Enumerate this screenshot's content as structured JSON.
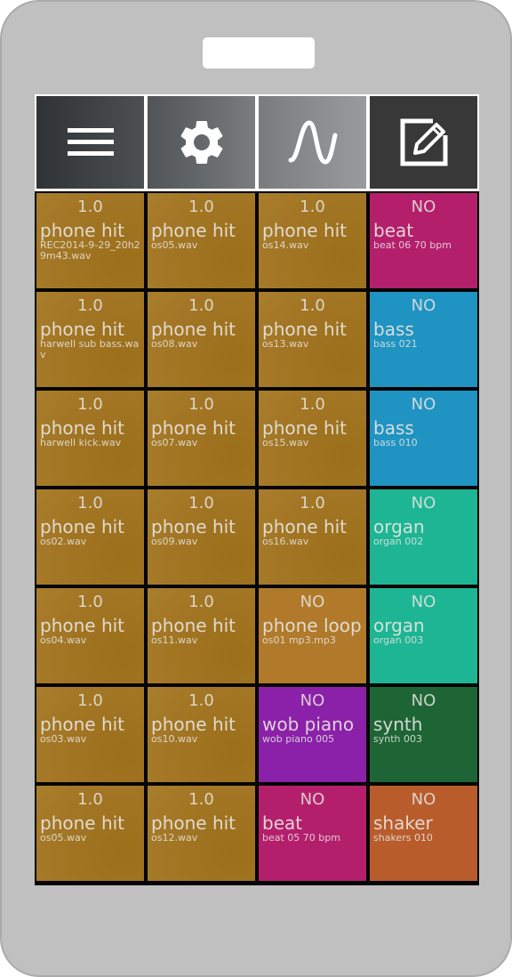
{
  "toolbar": {
    "buttons": [
      {
        "name": "menu-button",
        "icon": "menu-icon"
      },
      {
        "name": "settings-button",
        "icon": "gear-icon"
      },
      {
        "name": "waveform-button",
        "icon": "sine-wave-icon"
      },
      {
        "name": "edit-button",
        "icon": "edit-icon"
      }
    ]
  },
  "colors": {
    "brown": "#a27624",
    "brown_light": "#b07a2a",
    "magenta": "#b41f6c",
    "blue": "#1f93c1",
    "teal": "#1db594",
    "purple": "#8b21a8",
    "green": "#1e6535",
    "orange": "#b85c2c"
  },
  "pads": [
    [
      {
        "vol": "1.0",
        "name": "phone hit",
        "file": "REC2014-9-29_20h29m43.wav",
        "color": "brown"
      },
      {
        "vol": "1.0",
        "name": "phone hit",
        "file": "os05.wav",
        "color": "brown"
      },
      {
        "vol": "1.0",
        "name": "phone hit",
        "file": "os14.wav",
        "color": "brown"
      },
      {
        "vol": "NO",
        "name": "beat",
        "file": "beat 06 70 bpm",
        "color": "magenta"
      }
    ],
    [
      {
        "vol": "1.0",
        "name": "phone hit",
        "file": "harwell sub bass.wav",
        "color": "brown"
      },
      {
        "vol": "1.0",
        "name": "phone hit",
        "file": "os08.wav",
        "color": "brown"
      },
      {
        "vol": "1.0",
        "name": "phone hit",
        "file": "os13.wav",
        "color": "brown"
      },
      {
        "vol": "NO",
        "name": "bass",
        "file": "bass 021",
        "color": "blue"
      }
    ],
    [
      {
        "vol": "1.0",
        "name": "phone hit",
        "file": "harwell kick.wav",
        "color": "brown"
      },
      {
        "vol": "1.0",
        "name": "phone hit",
        "file": "os07.wav",
        "color": "brown"
      },
      {
        "vol": "1.0",
        "name": "phone hit",
        "file": "os15.wav",
        "color": "brown"
      },
      {
        "vol": "NO",
        "name": "bass",
        "file": "bass 010",
        "color": "blue"
      }
    ],
    [
      {
        "vol": "1.0",
        "name": "phone hit",
        "file": "os02.wav",
        "color": "brown"
      },
      {
        "vol": "1.0",
        "name": "phone hit",
        "file": "os09.wav",
        "color": "brown"
      },
      {
        "vol": "1.0",
        "name": "phone hit",
        "file": "os16.wav",
        "color": "brown"
      },
      {
        "vol": "NO",
        "name": "organ",
        "file": "organ 002",
        "color": "teal"
      }
    ],
    [
      {
        "vol": "1.0",
        "name": "phone hit",
        "file": "os04.wav",
        "color": "brown"
      },
      {
        "vol": "1.0",
        "name": "phone hit",
        "file": "os11.wav",
        "color": "brown"
      },
      {
        "vol": "NO",
        "name": "phone loop",
        "file": "os01 mp3.mp3",
        "color": "brown_light"
      },
      {
        "vol": "NO",
        "name": "organ",
        "file": "organ 003",
        "color": "teal"
      }
    ],
    [
      {
        "vol": "1.0",
        "name": "phone hit",
        "file": "os03.wav",
        "color": "brown"
      },
      {
        "vol": "1.0",
        "name": "phone hit",
        "file": "os10.wav",
        "color": "brown"
      },
      {
        "vol": "NO",
        "name": "wob piano",
        "file": "wob piano 005",
        "color": "purple"
      },
      {
        "vol": "NO",
        "name": "synth",
        "file": "synth 003",
        "color": "green"
      }
    ],
    [
      {
        "vol": "1.0",
        "name": "phone hit",
        "file": "os05.wav",
        "color": "brown"
      },
      {
        "vol": "1.0",
        "name": "phone hit",
        "file": "os12.wav",
        "color": "brown"
      },
      {
        "vol": "NO",
        "name": "beat",
        "file": "beat 05 70 bpm",
        "color": "magenta"
      },
      {
        "vol": "NO",
        "name": "shaker",
        "file": "shakers 010",
        "color": "orange"
      }
    ]
  ]
}
